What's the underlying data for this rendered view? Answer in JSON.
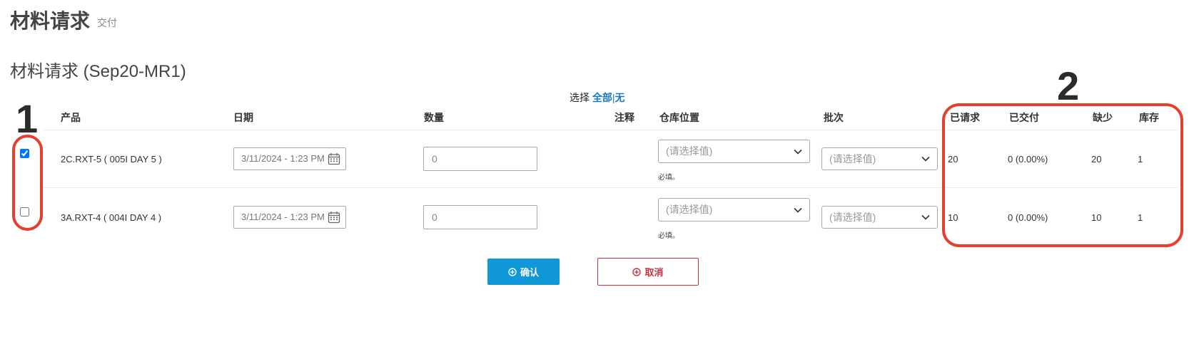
{
  "header": {
    "title": "材料请求",
    "subtitle": "交付"
  },
  "section_title": "材料请求 (Sep20-MR1)",
  "select_row": {
    "label": "选择",
    "all": "全部",
    "sep": "|",
    "none": "无"
  },
  "columns": {
    "product": "产品",
    "date": "日期",
    "quantity": "数量",
    "note": "注释",
    "location": "仓库位置",
    "batch": "批次",
    "requested": "已请求",
    "delivered": "已交付",
    "shortage": "缺少",
    "stock": "库存"
  },
  "rows": [
    {
      "checked": true,
      "product": "2C.RXT-5 ( 005I DAY 5 )",
      "date": "3/11/2024 - 1:23 PM",
      "quantity": "0",
      "location_placeholder": "(请选择值)",
      "location_required": "必填。",
      "batch_placeholder": "(请选择值)",
      "requested": "20",
      "delivered": "0 (0.00%)",
      "shortage": "20",
      "stock": "1"
    },
    {
      "checked": false,
      "product": "3A.RXT-4 ( 004I DAY 4 )",
      "date": "3/11/2024 - 1:23 PM",
      "quantity": "0",
      "location_placeholder": "(请选择值)",
      "location_required": "必填。",
      "batch_placeholder": "(请选择值)",
      "requested": "10",
      "delivered": "0 (0.00%)",
      "shortage": "10",
      "stock": "1"
    }
  ],
  "buttons": {
    "confirm": "确认",
    "cancel": "取消"
  },
  "annotations": {
    "marker1": "1",
    "marker2": "2"
  },
  "colors": {
    "accent": "#0f97d7",
    "link": "#1679c8",
    "cancel": "#c8323f",
    "annotation": "#e5402f"
  },
  "icons": [
    "calendar-icon",
    "chevron-down-icon",
    "circle-plus-icon"
  ]
}
